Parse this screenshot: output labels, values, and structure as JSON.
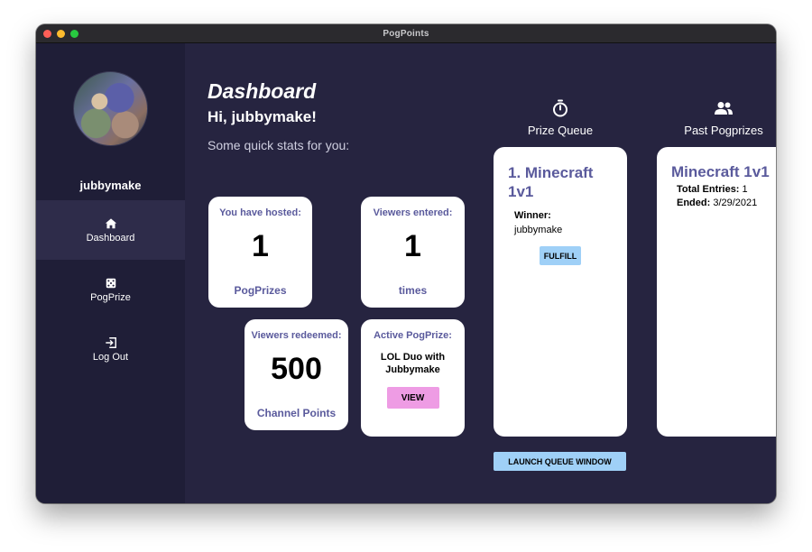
{
  "window": {
    "title": "PogPoints"
  },
  "sidebar": {
    "username": "jubbymake",
    "items": [
      {
        "label": "Dashboard",
        "icon": "home-icon",
        "active": true
      },
      {
        "label": "PogPrize",
        "icon": "dice-icon",
        "active": false
      },
      {
        "label": "Log Out",
        "icon": "logout-icon",
        "active": false
      }
    ]
  },
  "dashboard": {
    "title": "Dashboard",
    "greeting": "Hi, jubbymake!",
    "subtitle": "Some quick stats for you:",
    "stats": [
      {
        "label": "You have hosted:",
        "value": "1",
        "unit": "PogPrizes"
      },
      {
        "label": "Viewers entered:",
        "value": "1",
        "unit": "times"
      },
      {
        "label": "Viewers redeemed:",
        "value": "500",
        "unit": "Channel Points"
      }
    ],
    "active": {
      "label": "Active PogPrize:",
      "name": "LOL Duo with Jubbymake",
      "button": "VIEW"
    }
  },
  "queue": {
    "heading": "Prize Queue",
    "icon": "stopwatch-icon",
    "item_title": "1. Minecraft 1v1",
    "winner_label": "Winner:",
    "winner_name": "jubbymake",
    "fulfill_label": "FULFILL",
    "launch_label": "LAUNCH QUEUE WINDOW"
  },
  "past": {
    "heading": "Past Pogprizes",
    "icon": "users-icon",
    "item_title": "Minecraft 1v1",
    "entries_label": "Total Entries:",
    "entries_value": "1",
    "ended_label": "Ended:",
    "ended_value": "3/29/2021"
  },
  "colors": {
    "background": "#262440",
    "sidebar": "#1f1e37",
    "accent_text": "#5a5a9c",
    "button_blue": "#9fd0f7",
    "button_pink": "#ee9ce4"
  }
}
